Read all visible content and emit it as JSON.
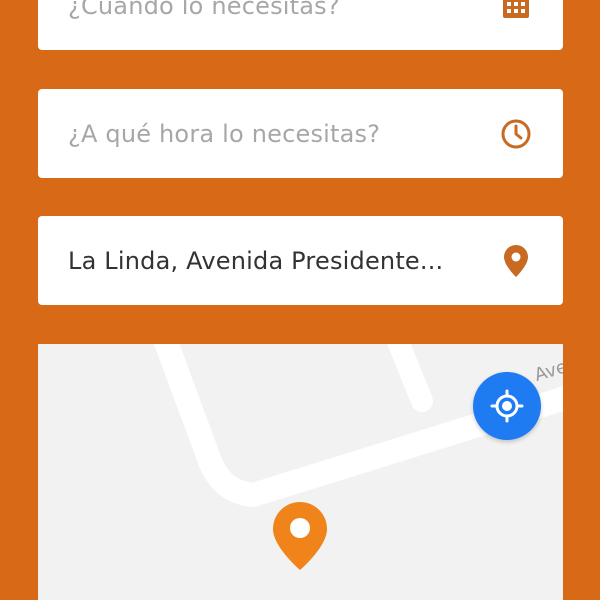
{
  "form": {
    "date_placeholder": "¿Cuándo lo necesitas?",
    "time_placeholder": "¿A qué hora lo necesitas?",
    "address_value": "La Linda, Avenida Presidente..."
  },
  "map": {
    "street_label": "Ave"
  },
  "icons": {
    "date": "calendar-icon",
    "time": "clock-icon",
    "address": "location-pin-icon",
    "locate": "my-location-icon",
    "map_pin": "map-marker-icon"
  },
  "colors": {
    "background": "#D86916",
    "icon_accent": "#C96A22",
    "locate_button": "#1E7BF2",
    "map_pin": "#F0841B",
    "placeholder_text": "#A7A7A7",
    "value_text": "#333333"
  }
}
